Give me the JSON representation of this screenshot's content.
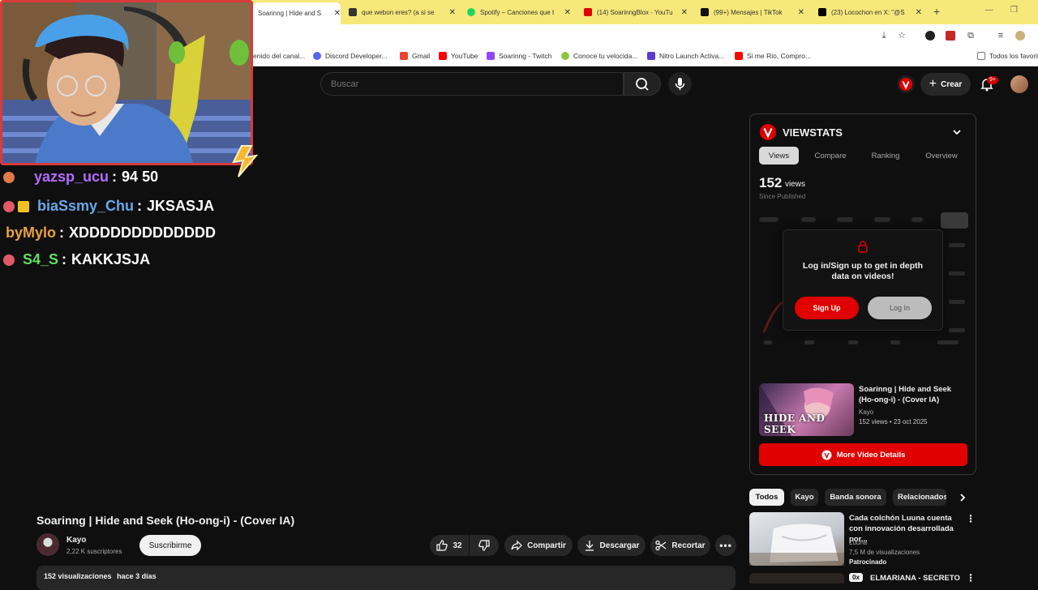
{
  "browser": {
    "tabs": [
      {
        "title": "Soarinng | Hide and S",
        "color": "#e00000",
        "active": true
      },
      {
        "title": "que webon eres? (a si se",
        "color": "#333333"
      },
      {
        "title": "Spotify – Canciones que t",
        "color": "#1ed760"
      },
      {
        "title": "(14) SoarinngBlox - YouTu",
        "color": "#e00000"
      },
      {
        "title": "(99+) Mensajes | TikTok",
        "color": "#111111"
      },
      {
        "title": "(23) Locochon en X: \"@S",
        "color": "#000000"
      }
    ],
    "bookmarks": [
      {
        "label": "enido del canal...",
        "color": "#888888"
      },
      {
        "label": "Discord Developer...",
        "color": "#5865f2"
      },
      {
        "label": "Gmail",
        "color": "#ea4335"
      },
      {
        "label": "YouTube",
        "color": "#ff0000"
      },
      {
        "label": "Soarinng - Twitch",
        "color": "#9146ff"
      },
      {
        "label": "Conoce tu velocida...",
        "color": "#8cc63f"
      },
      {
        "label": "Nitro Launch Activa...",
        "color": "#5b3bd6"
      },
      {
        "label": "Si me Rio, Compro...",
        "color": "#ff0000"
      },
      {
        "label": "Todos los favorit",
        "color": "#777777"
      }
    ]
  },
  "header": {
    "search_placeholder": "Buscar",
    "create_label": "Crear",
    "notif_badge": "9+"
  },
  "chat": [
    {
      "user": "yazsp_ucu",
      "sep": ":",
      "msg": "94 50",
      "user_color": "#b36bff",
      "badge_color": "#e07a4a"
    },
    {
      "user": "biaSsmy_Chu",
      "sep": ":",
      "msg": "JKSASJA",
      "user_color": "#6aa7e8",
      "badge_color": "#e05a6a"
    },
    {
      "user": "byMylo",
      "sep": ":",
      "msg": "XDDDDDDDDDDDDD",
      "user_color": "#e8a23a",
      "badge_color": ""
    },
    {
      "user": "S4_S",
      "sep": ":",
      "msg": "KAKKJSJA",
      "user_color": "#5ee05e",
      "badge_color": "#e05a6a"
    }
  ],
  "video": {
    "title": "Soarinng | Hide and Seek (Ho-ong-i) - (Cover IA)",
    "channel": "Kayo",
    "subscribers": "2,22 K suscriptores",
    "subscribe_label": "Suscribirme",
    "likes": "32",
    "share_label": "Compartir",
    "download_label": "Descargar",
    "clip_label": "Recortar",
    "views_label": "152 visualizaciones",
    "age_label": "hace 3 días"
  },
  "viewstats": {
    "brand": "VIEWSTATS",
    "tabs": [
      "Views",
      "Compare",
      "Ranking",
      "Overview"
    ],
    "views_count": "152",
    "views_unit": "views",
    "views_caption": "Since Published",
    "login_text": "Log in/Sign up to get in depth data on videos!",
    "signup_label": "Sign Up",
    "login_label": "Log In",
    "video_title": "Soarinng | Hide and Seek (Ho-ong-i) - (Cover IA)",
    "video_channel": "Kayo",
    "video_meta": "152 views • 23 oct 2025",
    "thumb_text": "HIDE AND SEEK",
    "more_details_label": "More Video Details",
    "accent": "#e00000"
  },
  "chips": [
    "Todos",
    "Kayo",
    "Banda sonora",
    "Relacionados"
  ],
  "recommendation": {
    "title": "Cada colchón Luuna cuenta con innovación desarrollada por...",
    "channel": "Luuna",
    "views": "7,5 M de visualizaciones",
    "sponsored": "Patrocinado",
    "next_badge": "0x",
    "next_title": "ELMARIANA - SECRETO"
  }
}
